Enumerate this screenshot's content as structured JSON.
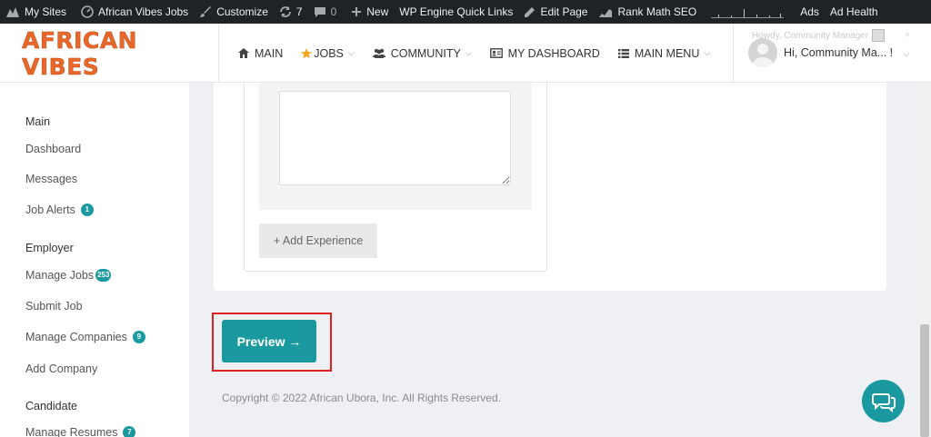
{
  "adminbar": {
    "my_sites": "My Sites",
    "site_name": "African Vibes Jobs",
    "customize": "Customize",
    "updates": "7",
    "comments": "0",
    "new": "New",
    "wp_engine": "WP Engine Quick Links",
    "edit_page": "Edit Page",
    "rank_math": "Rank Math SEO",
    "ads": "Ads",
    "ad_health": "Ad Health"
  },
  "header": {
    "logo": "AFRICAN VIBES",
    "nav": {
      "main": "MAIN",
      "jobs": "JOBS",
      "community": "COMMUNITY",
      "dashboard": "MY DASHBOARD",
      "main_menu": "MAIN MENU"
    },
    "howdy": "Howdy, Community Manager",
    "user_greeting": "Hi, Community Ma... !"
  },
  "sidebar": {
    "sections": [
      {
        "title": "Main",
        "items": [
          {
            "label": "Dashboard"
          },
          {
            "label": "Messages"
          },
          {
            "label": "Job Alerts",
            "badge": "1"
          }
        ]
      },
      {
        "title": "Employer",
        "items": [
          {
            "label": "Manage Jobs",
            "badge": "253"
          },
          {
            "label": "Submit Job"
          },
          {
            "label": "Manage Companies",
            "badge": "9"
          },
          {
            "label": "Add Company"
          }
        ]
      },
      {
        "title": "Candidate",
        "items": [
          {
            "label": "Manage Resumes",
            "badge": "7"
          }
        ]
      }
    ]
  },
  "form": {
    "add_experience": "+ Add Experience",
    "preview_button": "Preview →"
  },
  "footer": {
    "copyright": "Copyright © 2022 African Ubora, Inc. All Rights Reserved."
  },
  "colors": {
    "accent": "#1a9aa0",
    "logo": "#e8672a",
    "highlight": "#e02020",
    "adminbar": "#1d2327"
  }
}
